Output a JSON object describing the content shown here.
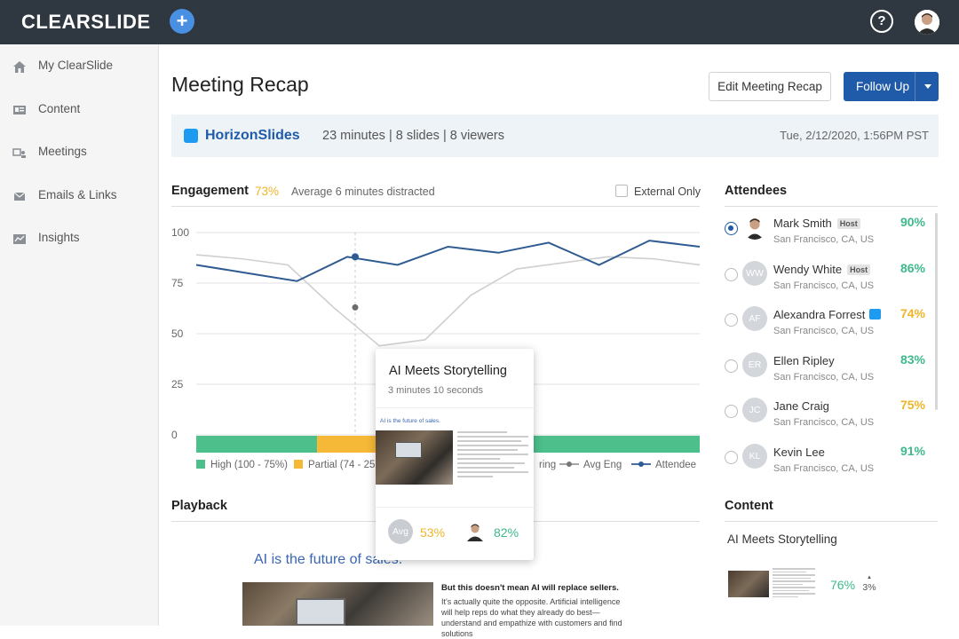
{
  "app": {
    "logo": "CLEARSLIDE",
    "add_icon": "plus-icon",
    "help_icon": "help-icon"
  },
  "colors": {
    "topbar": "#2f3740",
    "accent": "#1f5ba8",
    "high": "#4cbf8a",
    "partial": "#f5b937",
    "avg_line": "#cfcfcf",
    "attendee_line": "#2f5b93"
  },
  "sidebar": {
    "items": [
      {
        "label": "My ClearSlide",
        "icon": "home-icon"
      },
      {
        "label": "Content",
        "icon": "content-icon"
      },
      {
        "label": "Meetings",
        "icon": "meetings-icon"
      },
      {
        "label": "Emails & Links",
        "icon": "email-link-icon"
      },
      {
        "label": "Insights",
        "icon": "insights-icon"
      }
    ]
  },
  "header": {
    "title": "Meeting Recap",
    "edit_label": "Edit Meeting Recap",
    "follow_label": "Follow Up"
  },
  "meeting": {
    "name": "HorizonSlides",
    "stats": "23 minutes | 8 slides | 8 viewers",
    "date": "Tue, 2/12/2020, 1:56PM PST"
  },
  "engagement": {
    "title": "Engagement",
    "pct": "73%",
    "subtitle": "Average 6 minutes distracted",
    "external_label": "External Only",
    "legend": {
      "high": "High (100 - 75%)",
      "partial": "Partial (74 - 25",
      "ring_fragment": "ring",
      "avg": "Avg Eng",
      "attendee": "Attendee"
    }
  },
  "chart_data": {
    "type": "line",
    "title": "Engagement",
    "ylim": [
      0,
      100
    ],
    "yticks": [
      "100",
      "75",
      "50",
      "25",
      "0"
    ],
    "series": [
      {
        "name": "Avg Eng",
        "values": [
          89,
          87,
          84,
          63,
          44,
          47,
          69,
          82,
          85,
          88,
          87,
          84
        ]
      },
      {
        "name": "Attendee",
        "values": [
          84,
          80,
          76,
          88,
          84,
          93,
          90,
          95,
          84,
          96,
          93
        ]
      }
    ],
    "band": [
      {
        "level": "high",
        "from": 0,
        "to": 0.24
      },
      {
        "level": "partial",
        "from": 0.24,
        "to": 0.41
      },
      {
        "level": "high",
        "from": 0.41,
        "to": 1.0
      }
    ]
  },
  "popup": {
    "title": "AI Meets Storytelling",
    "duration": "3 minutes 10 seconds",
    "thumb_heading": "AI is the future of sales.",
    "avg_label": "Avg",
    "avg_pct": "53%",
    "attendee_pct": "82%"
  },
  "playback": {
    "title": "Playback",
    "slide_heading": "AI is the future of sales.",
    "slide_bold": "But this doesn't mean AI will replace sellers.",
    "slide_body": "It's actually quite the opposite. Artificial intelligence will help reps do what they already do best—understand and empathize with customers and find solutions"
  },
  "attendees": {
    "title": "Attendees",
    "host_label": "Host",
    "list": [
      {
        "name": "Mark Smith",
        "location": "San Francisco, CA, US",
        "pct": "90%",
        "initials": "",
        "host": true,
        "selected": true,
        "color": "#3dba8a"
      },
      {
        "name": "Wendy White",
        "location": "San Francisco, CA, US",
        "pct": "86%",
        "initials": "WW",
        "host": true,
        "selected": false,
        "color": "#3dba8a"
      },
      {
        "name": "Alexandra Forrest",
        "location": "San Francisco, CA, US",
        "pct": "74%",
        "initials": "AF",
        "host": false,
        "chat": true,
        "selected": false,
        "color": "#f0b429"
      },
      {
        "name": "Ellen Ripley",
        "location": "San Francisco, CA, US",
        "pct": "83%",
        "initials": "ER",
        "host": false,
        "selected": false,
        "color": "#3dba8a"
      },
      {
        "name": "Jane Craig",
        "location": "San Francisco, CA, US",
        "pct": "75%",
        "initials": "JC",
        "host": false,
        "selected": false,
        "color": "#f0b429"
      },
      {
        "name": "Kevin Lee",
        "location": "San Francisco, CA, US",
        "pct": "91%",
        "initials": "KL",
        "host": false,
        "selected": false,
        "color": "#3dba8a"
      }
    ]
  },
  "content": {
    "title": "Content",
    "item_name": "AI Meets Storytelling",
    "item_pct": "76%",
    "item_delta": "3%"
  }
}
